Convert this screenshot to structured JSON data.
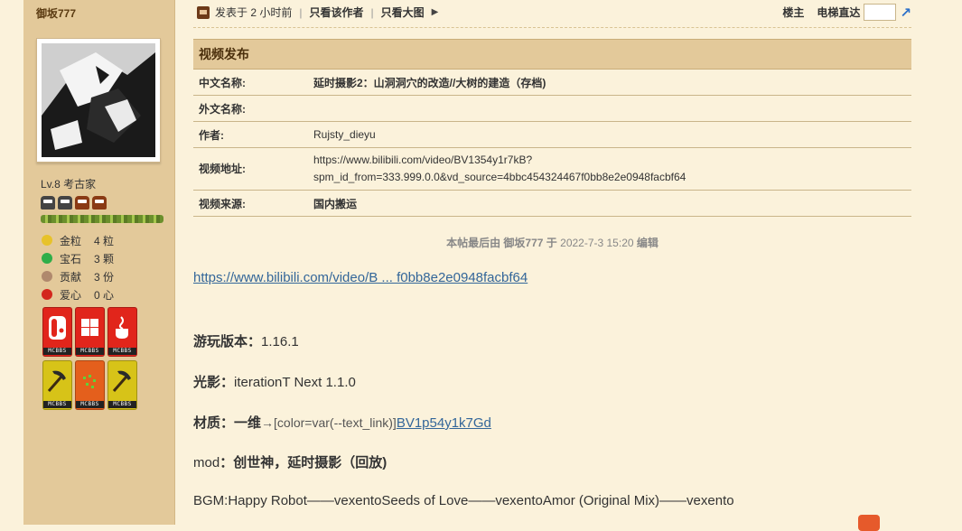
{
  "sidebar": {
    "username": "御坂777",
    "level": "Lv.8",
    "level_title": "考古家",
    "level_icon_colors": [
      "#444444",
      "#444444",
      "#8a3a14",
      "#8a3a14"
    ],
    "xp_fraction": 1.0,
    "stats": [
      {
        "label": "金粒",
        "value": "4 粒",
        "icon": "gold-nugget-icon",
        "color": "#e7c22a"
      },
      {
        "label": "宝石",
        "value": "3 颗",
        "icon": "emerald-icon",
        "color": "#2fae49"
      },
      {
        "label": "贡献",
        "value": "3 份",
        "icon": "contribution-icon",
        "color": "#b0896d"
      },
      {
        "label": "爱心",
        "value": "0 心",
        "icon": "heart-apple-icon",
        "color": "#d3271d"
      }
    ],
    "medals": [
      {
        "icon": "switch-medal-icon",
        "color": "#e1251b",
        "tag": "MCBBS"
      },
      {
        "icon": "windows-medal-icon",
        "color": "#e1251b",
        "tag": "MCBBS"
      },
      {
        "icon": "java-medal-icon",
        "color": "#e1251b",
        "tag": "MCBBS"
      },
      {
        "icon": "pickaxe-medal-icon",
        "color": "#d7c318",
        "tag": "MCBBS"
      },
      {
        "icon": "seeds-medal-icon",
        "color": "#e45f1c",
        "tag": "MCBBS"
      },
      {
        "icon": "pickaxe-medal-icon",
        "color": "#d7c318",
        "tag": "MCBBS"
      }
    ]
  },
  "header": {
    "posted": "发表于 2 小时前",
    "only_author": "只看该作者",
    "big_images": "只看大图",
    "floor": "楼主",
    "elevator": "电梯直达"
  },
  "video_table": {
    "title": "视频发布",
    "rows": [
      {
        "key": "中文名称:",
        "value": "延时摄影2：山洞洞穴的改造//大树的建造（存档)",
        "bold": true
      },
      {
        "key": "外文名称:",
        "value": ""
      },
      {
        "key": "作者:",
        "value": "Rujsty_dieyu"
      },
      {
        "key": "视频地址:",
        "value_line1": "https://www.bilibili.com/video/BV1354y1r7kB?",
        "value_line2": "spm_id_from=333.999.0.0&vd_source=4bbc454324467f0bb8e2e0948facbf64"
      },
      {
        "key": "视频来源:",
        "value": "国内搬运",
        "bold": true
      }
    ]
  },
  "edit_note": {
    "prefix": "本帖最后由 御坂777 于",
    "time": "2022-7-3 15:20",
    "suffix": "编辑"
  },
  "body": {
    "link": "https://www.bilibili.com/video/B ... f0bb8e2e0948facbf64",
    "version_label": "游玩版本",
    "version_value": "1.16.1",
    "shader_label": "光影",
    "shader_value": "iterationT Next 1.1.0",
    "material_label": "材质",
    "material_value": "一维",
    "material_inline": "→[color=var(--text_link)]",
    "material_link": "BV1p54y1k7Gd",
    "mod_label": "mod",
    "mod_value": "创世神，延时摄影（回放)",
    "bgm": "BGM:Happy Robot——vexentoSeeds of Love——vexentoAmor (Original Mix)——vexento"
  },
  "colors": {
    "sidebar_bg": "#e3c99a",
    "page_bg": "#fbf2db",
    "link": "#336699"
  }
}
